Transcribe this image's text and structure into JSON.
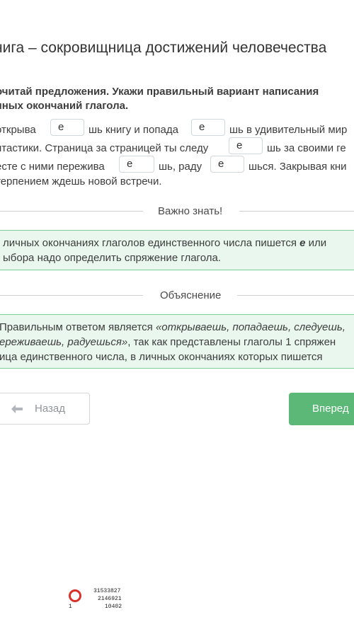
{
  "title": "нига – сокровищница достижений человечества",
  "instruction": {
    "line1": "очитай предложения. Укажи правильный вариант написания",
    "line2": "чных окончаний глагола."
  },
  "exercise": {
    "l1_a": "открыва",
    "blank1": "е",
    "l1_b": "шь книгу и попада",
    "blank2": "е",
    "l1_c": "шь в удивительный мир",
    "l2_a": "нтастики. Страница за страницей ты следу",
    "blank3": "е",
    "l2_b": "шь за своими ге",
    "l3_a": "есте с ними пережива",
    "blank4": "е",
    "l3_b": "шь, раду",
    "blank5": "е",
    "l3_c": "шься. Закрывая кни",
    "l4": "терпением ждешь новой встречи."
  },
  "important": {
    "label": "Важно знать!",
    "line1_a": "личных окончаниях глаголов единственного числа пишется ",
    "line1_b": "е",
    "line1_c": " или",
    "line2": "ыбора надо определить спряжение глагола."
  },
  "explanation": {
    "label": "Объяснение",
    "line1_a": "Правильным ответом является ",
    "line1_b": "«открываешь, попадаешь, следуешь,",
    "line2_a": "ереживаешь, радуешься»",
    "line2_b": ", так как представлены глаголы 1 спряжен",
    "line3": "ица единственного числа, в личных окончаниях которых пишется"
  },
  "nav": {
    "back_label": "Назад",
    "next_label": "Вперед"
  },
  "stamp": {
    "num1": "31533827",
    "num2": "2146921",
    "num3": "1",
    "num4": "10402"
  },
  "colors": {
    "accent_green": "#5cb876",
    "note_bg": "#e9f7ee",
    "note_border": "#7ccf98"
  }
}
